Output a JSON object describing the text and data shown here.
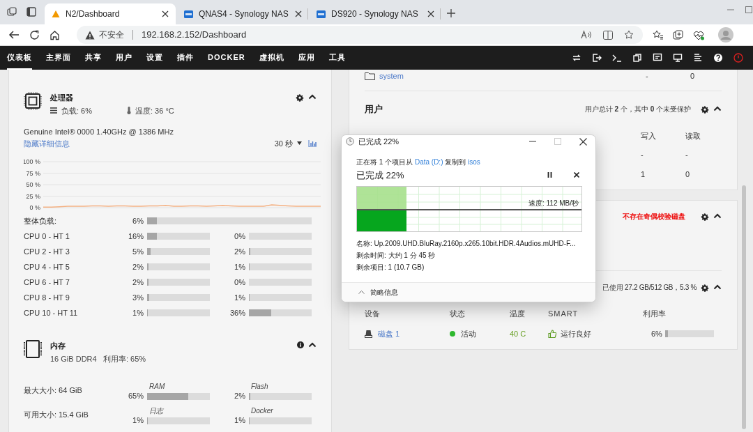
{
  "browser": {
    "tabs": [
      {
        "title": "N2/Dashboard",
        "kind": "warning",
        "selected": true
      },
      {
        "title": "QNAS4 - Synology NAS",
        "kind": "app",
        "selected": false
      },
      {
        "title": "DS920 - Synology NAS",
        "kind": "app",
        "selected": false
      }
    ],
    "security": "不安全",
    "url": "192.168.2.152/Dashboard"
  },
  "nav": {
    "items": [
      {
        "label": "仪表板",
        "selected": true
      },
      {
        "label": "主界面",
        "selected": false
      },
      {
        "label": "共享",
        "selected": false
      },
      {
        "label": "用户",
        "selected": false
      },
      {
        "label": "设置",
        "selected": false
      },
      {
        "label": "插件",
        "selected": false
      },
      {
        "label": "DOCKER",
        "selected": false
      },
      {
        "label": "虚拟机",
        "selected": false
      },
      {
        "label": "应用",
        "selected": false
      },
      {
        "label": "工具",
        "selected": false
      }
    ]
  },
  "processor": {
    "title": "处理器",
    "load": "负载: 6%",
    "temperature": "温度: 36 °C",
    "model": "Genuine Intel® 0000 1.40GHz @ 1386 MHz",
    "details_link": "隐藏详细信息",
    "interval": "30 秒",
    "chart_data": {
      "type": "line",
      "grid": true,
      "ylim": [
        0,
        100
      ],
      "yticks": [
        {
          "value": 0,
          "label": "0 %"
        },
        {
          "value": 25,
          "label": "25 %"
        },
        {
          "value": 50,
          "label": "50 %"
        },
        {
          "value": 75,
          "label": "75 %"
        },
        {
          "value": 100,
          "label": "100 %"
        }
      ],
      "series": [
        {
          "color": "#f4b183",
          "values": [
            1,
            1,
            2,
            3,
            3,
            3,
            4,
            4,
            3,
            4,
            4,
            3,
            3,
            4,
            4,
            5,
            3,
            3,
            4,
            4,
            3,
            4,
            5,
            4,
            3,
            3,
            3,
            3,
            6,
            5,
            4,
            3,
            3,
            3,
            3
          ]
        }
      ]
    },
    "overall": {
      "label": "整体负载:",
      "value": "6%",
      "level": 0.06
    },
    "cores": [
      {
        "label": "CPU 0 - HT 1",
        "cells": [
          {
            "value": "16%",
            "level": 0.16
          },
          {
            "value": "0%",
            "level": 0
          }
        ]
      },
      {
        "label": "CPU 2 - HT 3",
        "cells": [
          {
            "value": "5%",
            "level": 0.05
          },
          {
            "value": "2%",
            "level": 0.02
          }
        ]
      },
      {
        "label": "CPU 4 - HT 5",
        "cells": [
          {
            "value": "2%",
            "level": 0.02
          },
          {
            "value": "1%",
            "level": 0.01
          }
        ]
      },
      {
        "label": "CPU 6 - HT 7",
        "cells": [
          {
            "value": "2%",
            "level": 0.02
          },
          {
            "value": "0%",
            "level": 0
          }
        ]
      },
      {
        "label": "CPU 8 - HT 9",
        "cells": [
          {
            "value": "3%",
            "level": 0.03
          },
          {
            "value": "1%",
            "level": 0.01
          }
        ]
      },
      {
        "label": "CPU 10 - HT 11",
        "cells": [
          {
            "value": "1%",
            "level": 0.01
          },
          {
            "value": "36%",
            "level": 0.36
          }
        ]
      }
    ]
  },
  "memory": {
    "title": "内存",
    "type": "16 GiB DDR4",
    "usage": "利用率: 65%",
    "rows": [
      {
        "label": "最大大小: 64 GiB",
        "cells": [
          {
            "caption": "RAM",
            "value": "65%",
            "level": 0.65
          },
          {
            "caption": "Flash",
            "value": "2%",
            "level": 0.02
          }
        ]
      },
      {
        "label": "可用大小: 15.4 GiB",
        "cells": [
          {
            "caption": "日志",
            "value": "1%",
            "level": 0.01
          },
          {
            "caption": "Docker",
            "value": "1%",
            "level": 0.01
          }
        ]
      }
    ]
  },
  "shares": {
    "rows": [
      {
        "name": "system",
        "write": "-",
        "read": "0"
      }
    ]
  },
  "users": {
    "title": "用户",
    "summary": "用户总计 **2** 个，其中 **0** 个未受保护",
    "columns": [
      "写入",
      "读取"
    ],
    "rows": [
      [
        "-",
        "-"
      ],
      [
        "1",
        "0"
      ]
    ]
  },
  "parity": {
    "message": "不存在奇偶校验磁盘"
  },
  "disks": {
    "summary": "已使用 27.2 GB/512 GB，5.3 %",
    "columns": [
      "设备",
      "状态",
      "温度",
      "SMART",
      "利用率"
    ],
    "rows": [
      {
        "device": "磁盘 1",
        "status": "活动",
        "color": "#2eb82e",
        "temperature": "40 C",
        "smart": "运行良好",
        "usage": "6%",
        "level": 0.06
      }
    ]
  },
  "dialog": {
    "title": "已完成 22%",
    "copy_prefix": "正在将 1 个项目从 ",
    "source": "Data (D:)",
    "copy_middle": " 复制到 ",
    "destination": "isos",
    "heading": "已完成 22%",
    "level": 0.22,
    "speed": "速度: 112 MB/秒",
    "details": [
      "名称: Up.2009.UHD.BluRay.2160p.x265.10bit.HDR.4Audios.mUHD-F...",
      "剩余时间: 大约 1 分 45 秒",
      "剩余项目: 1 (10.7 GB)"
    ],
    "less_info": "简略信息"
  }
}
